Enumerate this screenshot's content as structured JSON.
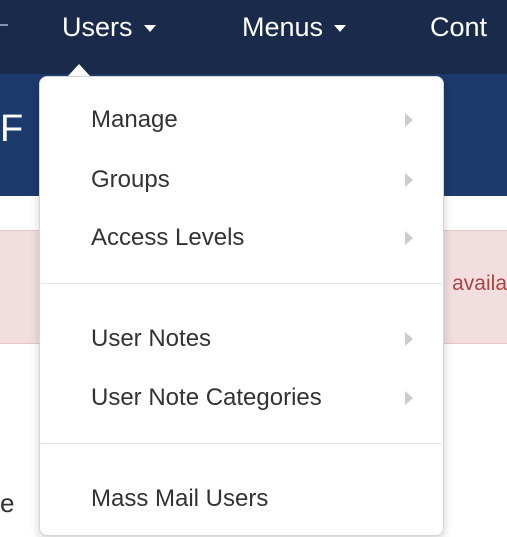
{
  "navbar": {
    "items": [
      {
        "label": "Users"
      },
      {
        "label": "Menus"
      },
      {
        "label": "Cont"
      }
    ]
  },
  "header": {
    "title_fragment": "F"
  },
  "alert": {
    "text_fragment": "availa"
  },
  "body_fragment": "e",
  "dropdown": {
    "groups": [
      {
        "items": [
          {
            "label": "Manage",
            "has_submenu": true
          },
          {
            "label": "Groups",
            "has_submenu": true
          },
          {
            "label": "Access Levels",
            "has_submenu": true
          }
        ]
      },
      {
        "items": [
          {
            "label": "User Notes",
            "has_submenu": true
          },
          {
            "label": "User Note Categories",
            "has_submenu": true
          }
        ]
      },
      {
        "items": [
          {
            "label": "Mass Mail Users",
            "has_submenu": false
          }
        ]
      }
    ]
  },
  "colors": {
    "navbar": "#1a2a4a",
    "header": "#1d3a6d",
    "alert_bg": "#f2dede",
    "alert_text": "#a94442",
    "menu_text": "#333333"
  }
}
